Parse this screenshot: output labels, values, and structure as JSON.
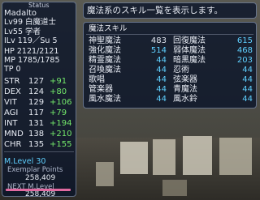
{
  "status": {
    "title": "Status",
    "name": "Madalto",
    "main_job": "Lv99 白魔道士",
    "sub_job": "Lv55 学者",
    "ilv": "ILv 119／Su 5",
    "hp": "HP 2121/2121",
    "mp": "MP 1785/1785",
    "tp": "TP 0",
    "stats": [
      {
        "label": "STR",
        "base": "127",
        "bonus": "+91"
      },
      {
        "label": "DEX",
        "base": "124",
        "bonus": "+80"
      },
      {
        "label": "VIT",
        "base": "129",
        "bonus": "+106"
      },
      {
        "label": "AGI",
        "base": "117",
        "bonus": "+79"
      },
      {
        "label": "INT",
        "base": "131",
        "bonus": "+194"
      },
      {
        "label": "MND",
        "base": "138",
        "bonus": "+210"
      },
      {
        "label": "CHR",
        "base": "135",
        "bonus": "+155"
      }
    ],
    "mlevel": "M.Level 30",
    "exemplar_label": "Exemplar Points",
    "exemplar_value": "258,409",
    "next_label": "NEXT M.Level",
    "next_value": "258,409"
  },
  "help_text": "魔法系のスキル一覧を表示します。",
  "skills": {
    "header": "魔法スキル",
    "left": [
      {
        "name": "神聖魔法",
        "value": "483",
        "highlight": false
      },
      {
        "name": "強化魔法",
        "value": "514",
        "highlight": true
      },
      {
        "name": "精霊魔法",
        "value": "44",
        "highlight": true
      },
      {
        "name": "召喚魔法",
        "value": "44",
        "highlight": true
      },
      {
        "name": "歌唱",
        "value": "44",
        "highlight": true
      },
      {
        "name": "管楽器",
        "value": "44",
        "highlight": true
      },
      {
        "name": "風水魔法",
        "value": "44",
        "highlight": true
      }
    ],
    "right": [
      {
        "name": "回復魔法",
        "value": "615",
        "highlight": true
      },
      {
        "name": "弱体魔法",
        "value": "468",
        "highlight": true
      },
      {
        "name": "暗黒魔法",
        "value": "203",
        "highlight": true
      },
      {
        "name": "忍術",
        "value": "44",
        "highlight": true
      },
      {
        "name": "弦楽器",
        "value": "44",
        "highlight": true
      },
      {
        "name": "青魔法",
        "value": "44",
        "highlight": true
      },
      {
        "name": "風水鈴",
        "value": "44",
        "highlight": true
      }
    ]
  },
  "colors": {
    "highlight": "#5fd0ff",
    "bonus": "#73e86a",
    "bar_pink": "#e06aa0"
  }
}
